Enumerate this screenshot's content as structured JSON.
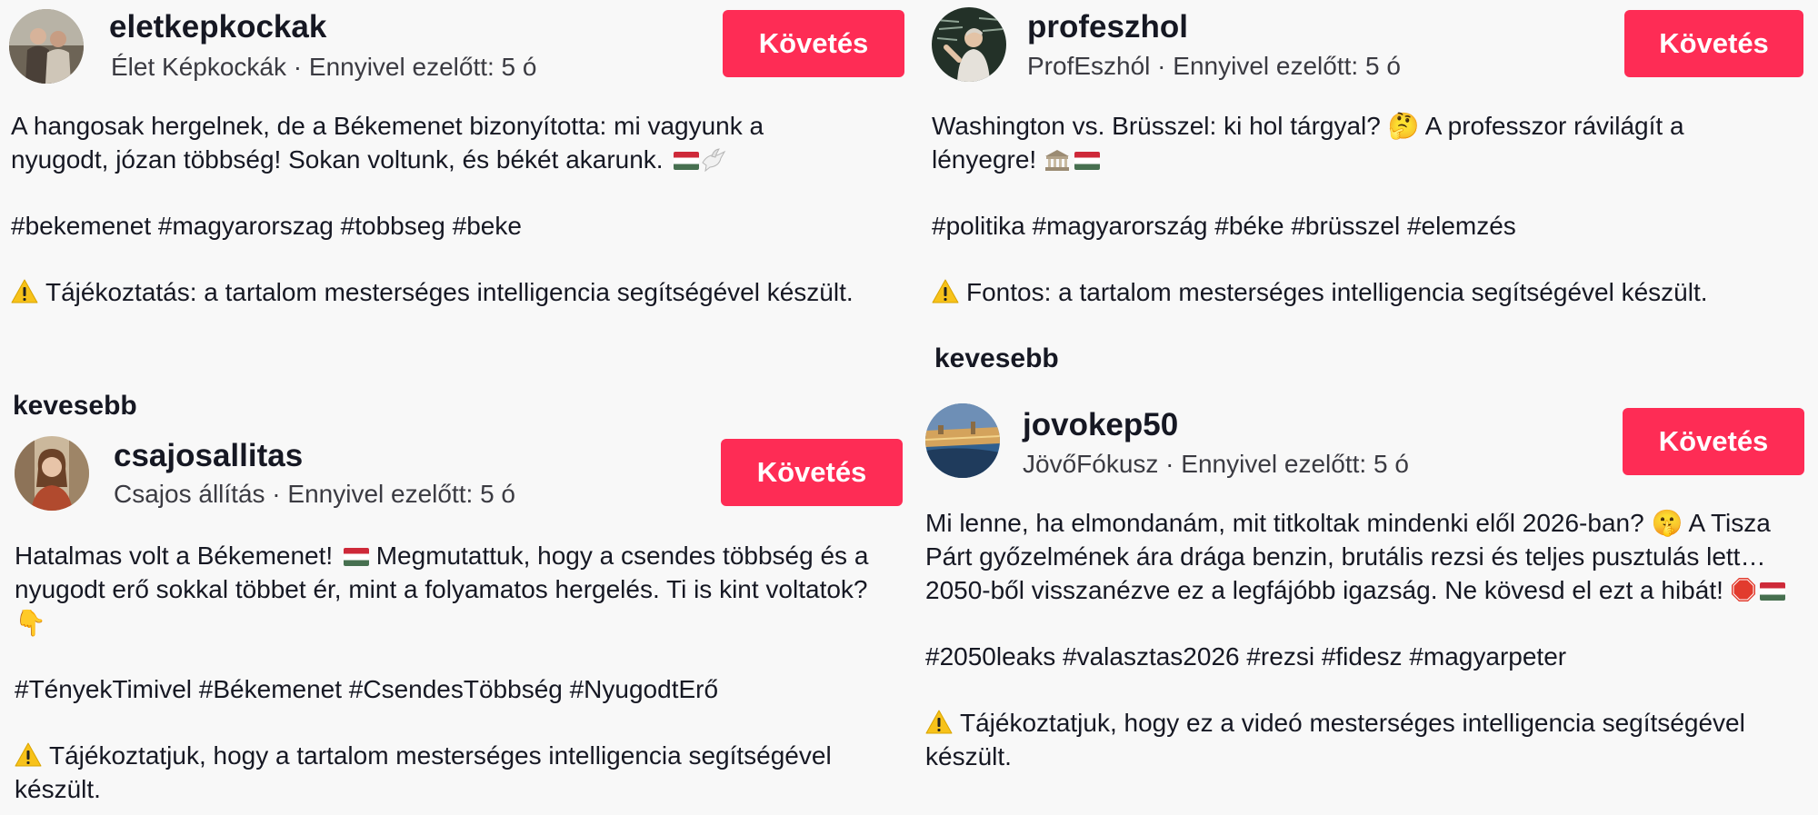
{
  "posts": [
    {
      "username": "eletkepkockak",
      "display_name": "Élet Képkockák",
      "time": "Ennyivel ezelőtt: 5 ó",
      "follow_label": "Követés",
      "caption": "A hangosak hergelnek, de a Békemenet bizonyította: mi vagyunk a nyugodt, józan többség! Sokan voltunk, és békét akarunk.",
      "hashtags": "#bekemenet #magyarorszag #tobbseg #beke",
      "disclaimer": "Tájékoztatás: a tartalom mesterséges intelligencia segítségével készült.",
      "less_label": "kevesebb"
    },
    {
      "username": "profeszhol",
      "display_name": "ProfEszhól",
      "time": "Ennyivel ezelőtt: 5 ó",
      "follow_label": "Követés",
      "caption": "Washington vs. Brüsszel: ki hol tárgyal? 🤔 A professzor rávilágít a lényegre!",
      "hashtags": "#politika #magyarország #béke #brüsszel #elemzés",
      "disclaimer": "Fontos: a tartalom mesterséges intelligencia segítségével készült.",
      "less_label": "kevesebb"
    },
    {
      "username": "csajosallitas",
      "display_name": "Csajos állítás",
      "time": "Ennyivel ezelőtt: 5 ó",
      "follow_label": "Követés",
      "caption_a": "Hatalmas volt a Békemenet!",
      "caption_b": "Megmutattuk, hogy a csendes többség és a nyugodt erő sokkal többet ér, mint a folyamatos hergelés. Ti is kint voltatok? 👇",
      "hashtags": "#TényekTimivel #Békemenet #CsendesTöbbség #NyugodtErő",
      "disclaimer": "Tájékoztatjuk, hogy a tartalom mesterséges intelligencia segítségével készült."
    },
    {
      "username": "jovokep50",
      "display_name": "JövőFókusz",
      "time": "Ennyivel ezelőtt: 5 ó",
      "follow_label": "Követés",
      "caption": "Mi lenne, ha elmondanám, mit titkoltak mindenki elől 2026-ban? 🤫 A Tisza Párt győzelmének ára drága benzin, brutális rezsi és teljes pusztulás lett… 2050-ből visszanézve ez a legfájóbb igazság. Ne kövesd el ezt a hibát!",
      "hashtags": "#2050leaks #valasztas2026 #rezsi #fidesz #magyarpeter",
      "disclaimer": "Tájékoztatjuk, hogy ez a videó mesterséges intelligencia segítségével készült."
    }
  ],
  "colors": {
    "follow_bg": "#fe2c55",
    "text": "#161823",
    "meta": "#3b3b42",
    "background": "#f8f8f8"
  },
  "icons": [
    "warning-icon",
    "hungary-flag-icon",
    "dove-icon",
    "classical-building-icon",
    "stop-sign-icon"
  ]
}
